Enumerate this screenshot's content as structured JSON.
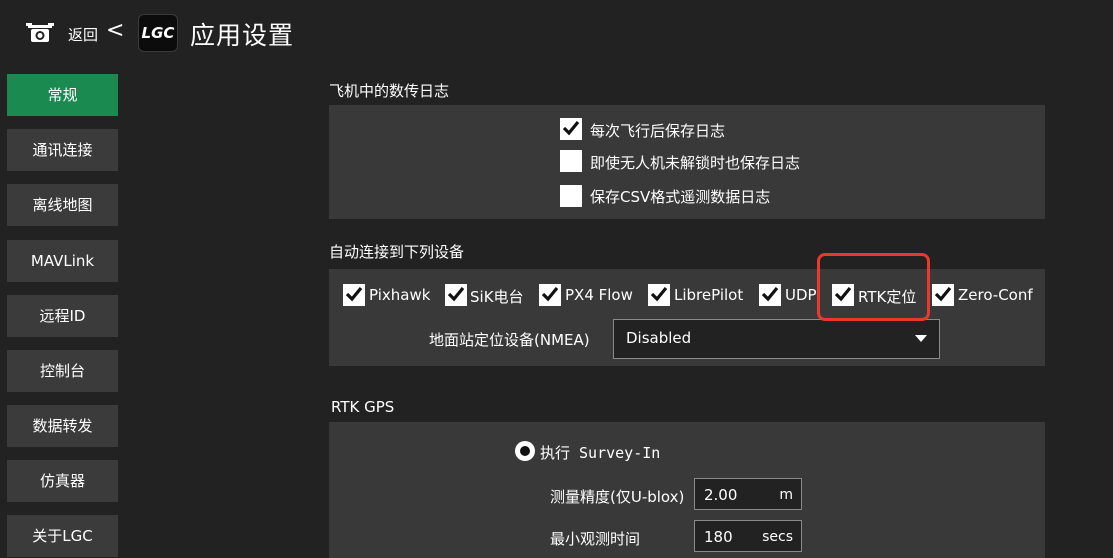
{
  "toolbar": {
    "camera_icon": "camera-icon",
    "back_label": "返回",
    "back_chevron": "<",
    "logo_text": "LGC",
    "title": "应用设置"
  },
  "sidebar": {
    "items": [
      {
        "label": "常规",
        "active": true
      },
      {
        "label": "通讯连接",
        "active": false
      },
      {
        "label": "离线地图",
        "active": false
      },
      {
        "label": "MAVLink",
        "active": false
      },
      {
        "label": "远程ID",
        "active": false
      },
      {
        "label": "控制台",
        "active": false
      },
      {
        "label": "数据转发",
        "active": false
      },
      {
        "label": "仿真器",
        "active": false
      },
      {
        "label": "关于LGC",
        "active": false
      }
    ]
  },
  "telemetry_logs": {
    "section_label": "飞机中的数传日志",
    "options": [
      {
        "label": "每次飞行后保存日志",
        "checked": true
      },
      {
        "label": "即使无人机未解锁时也保存日志",
        "checked": false
      },
      {
        "label": "保存CSV格式遥测数据日志",
        "checked": false
      }
    ]
  },
  "autoconnect": {
    "section_label": "自动连接到下列设备",
    "devices": [
      {
        "label": "Pixhawk",
        "checked": true
      },
      {
        "label": "SiK电台",
        "checked": true
      },
      {
        "label": "PX4 Flow",
        "checked": true
      },
      {
        "label": "LibrePilot",
        "checked": true
      },
      {
        "label": "UDP",
        "checked": true
      },
      {
        "label": "RTK定位",
        "checked": true
      },
      {
        "label": "Zero-Conf",
        "checked": true
      }
    ],
    "nmea_label": "地面站定位设备(NMEA)",
    "nmea_value": "Disabled"
  },
  "rtk": {
    "section_label": "RTK GPS",
    "survey_label": "执行 Survey-In",
    "accuracy_label": "测量精度(仅U-blox)",
    "accuracy_value": "2.00",
    "accuracy_unit": "m",
    "min_time_label": "最小观测时间",
    "min_time_value": "180",
    "min_time_unit": "secs"
  },
  "colors": {
    "background": "#222222",
    "panel": "#393939",
    "nav_button": "#3b3b3b",
    "nav_active": "#1a8a50",
    "highlight": "#e53a2e"
  }
}
